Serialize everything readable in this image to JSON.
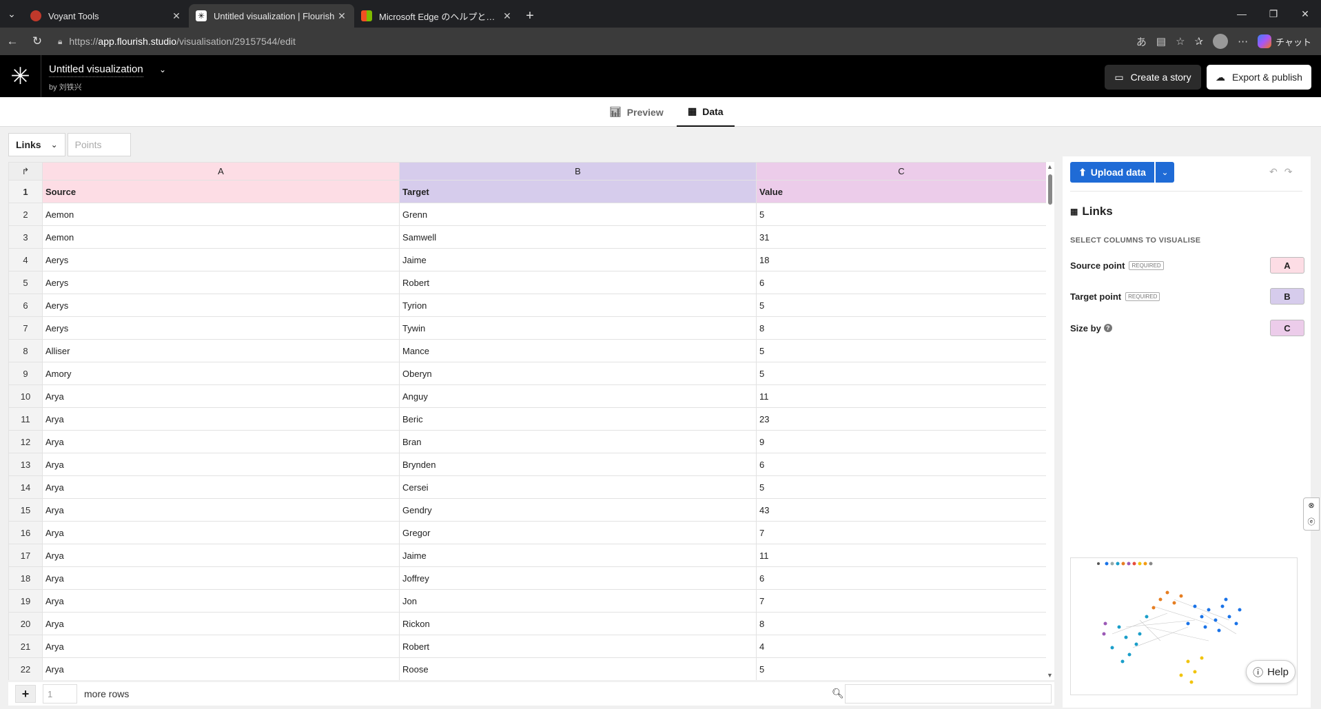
{
  "browser": {
    "tabs": [
      {
        "title": "Voyant Tools",
        "fav_color": "#c0392b"
      },
      {
        "title": "Untitled visualization | Flourish",
        "fav_color": "#ffffff"
      },
      {
        "title": "Microsoft Edge のヘルプとラーニング",
        "fav_color": "#f25022"
      }
    ],
    "url_prefix": "https://",
    "url_host": "app.flourish.studio",
    "url_path": "/visualisation/29157544/edit",
    "copilot_label": "チャット"
  },
  "header": {
    "title": "Untitled visualization",
    "author": "by 刘铁兴",
    "create_story": "Create a story",
    "export_publish": "Export & publish"
  },
  "view_tabs": {
    "preview": "Preview",
    "data": "Data"
  },
  "sheet_tabs": {
    "links": "Links",
    "points": "Points"
  },
  "grid": {
    "col_letters": [
      "A",
      "B",
      "C"
    ],
    "rows": [
      {
        "n": "1",
        "a": "Source",
        "b": "Target",
        "c": "Value"
      },
      {
        "n": "2",
        "a": "Aemon",
        "b": "Grenn",
        "c": "5"
      },
      {
        "n": "3",
        "a": "Aemon",
        "b": "Samwell",
        "c": "31"
      },
      {
        "n": "4",
        "a": "Aerys",
        "b": "Jaime",
        "c": "18"
      },
      {
        "n": "5",
        "a": "Aerys",
        "b": "Robert",
        "c": "6"
      },
      {
        "n": "6",
        "a": "Aerys",
        "b": "Tyrion",
        "c": "5"
      },
      {
        "n": "7",
        "a": "Aerys",
        "b": "Tywin",
        "c": "8"
      },
      {
        "n": "8",
        "a": "Alliser",
        "b": "Mance",
        "c": "5"
      },
      {
        "n": "9",
        "a": "Amory",
        "b": "Oberyn",
        "c": "5"
      },
      {
        "n": "10",
        "a": "Arya",
        "b": "Anguy",
        "c": "11"
      },
      {
        "n": "11",
        "a": "Arya",
        "b": "Beric",
        "c": "23"
      },
      {
        "n": "12",
        "a": "Arya",
        "b": "Bran",
        "c": "9"
      },
      {
        "n": "13",
        "a": "Arya",
        "b": "Brynden",
        "c": "6"
      },
      {
        "n": "14",
        "a": "Arya",
        "b": "Cersei",
        "c": "5"
      },
      {
        "n": "15",
        "a": "Arya",
        "b": "Gendry",
        "c": "43"
      },
      {
        "n": "16",
        "a": "Arya",
        "b": "Gregor",
        "c": "7"
      },
      {
        "n": "17",
        "a": "Arya",
        "b": "Jaime",
        "c": "11"
      },
      {
        "n": "18",
        "a": "Arya",
        "b": "Joffrey",
        "c": "6"
      },
      {
        "n": "19",
        "a": "Arya",
        "b": "Jon",
        "c": "7"
      },
      {
        "n": "20",
        "a": "Arya",
        "b": "Rickon",
        "c": "8"
      },
      {
        "n": "21",
        "a": "Arya",
        "b": "Robert",
        "c": "4"
      },
      {
        "n": "22",
        "a": "Arya",
        "b": "Roose",
        "c": "5"
      }
    ]
  },
  "bottom": {
    "row_count": "1",
    "more_rows": "more rows"
  },
  "panel": {
    "upload": "Upload data",
    "section_title": "Links",
    "select_hint": "SELECT COLUMNS TO VISUALISE",
    "bindings": [
      {
        "label": "Source point",
        "required": "REQUIRED",
        "col": "A",
        "color": "#fddde5"
      },
      {
        "label": "Target point",
        "required": "REQUIRED",
        "col": "B",
        "color": "#d6ccec"
      },
      {
        "label": "Size by",
        "required": "",
        "col": "C",
        "color": "#ecccea"
      }
    ],
    "help": "Help"
  }
}
